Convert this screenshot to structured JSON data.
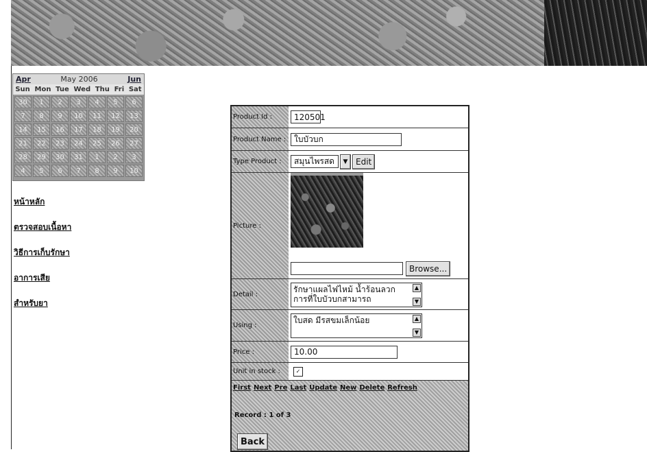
{
  "calendar": {
    "prev": "Apr",
    "title": "May 2006",
    "next": "Jun",
    "weekdays": [
      "Sun",
      "Mon",
      "Tue",
      "Wed",
      "Thu",
      "Fri",
      "Sat"
    ],
    "days": [
      "30",
      "1",
      "2",
      "3",
      "4",
      "5",
      "6",
      "7",
      "8",
      "9",
      "10",
      "11",
      "12",
      "13",
      "14",
      "15",
      "16",
      "17",
      "18",
      "19",
      "20",
      "21",
      "22",
      "23",
      "24",
      "25",
      "26",
      "27",
      "28",
      "29",
      "30",
      "31",
      "1",
      "2",
      "3",
      "4",
      "5",
      "6",
      "7",
      "8",
      "9",
      "10"
    ]
  },
  "nav": {
    "items": [
      "หน้าหลัก",
      "ตรวจสอบเนื้อหา",
      "วิธีการเก็บรักษา",
      "อาการเสีย",
      "สำหรับยา"
    ]
  },
  "form": {
    "product_id_label": "Product Id :",
    "product_id_value": "120501",
    "product_name_label": "Product Name :",
    "product_name_value": "ใบบัวบก",
    "type_label": "Type Product :",
    "type_value": "สมุนไพรสด",
    "edit_label": "Edit",
    "picture_label": "Picture :",
    "browse_label": "Browse...",
    "detail_label": "Detail :",
    "detail_value": "รักษาแผลไฟไหม้ น้ำร้อนลวก การที่ใบบัวบกสามารถ",
    "using_label": "Using :",
    "using_value": "ใบสด มีรสขมเล็กน้อย",
    "price_label": "Price :",
    "price_value": "10.00",
    "stock_label": "Unit in stock :",
    "stock_checked": "✓",
    "nav_links": [
      "First",
      "Next",
      "Pre",
      "Last",
      "Update",
      "New",
      "Delete",
      "Refresh"
    ],
    "record": "Record : 1 of 3",
    "back_label": "Back"
  }
}
